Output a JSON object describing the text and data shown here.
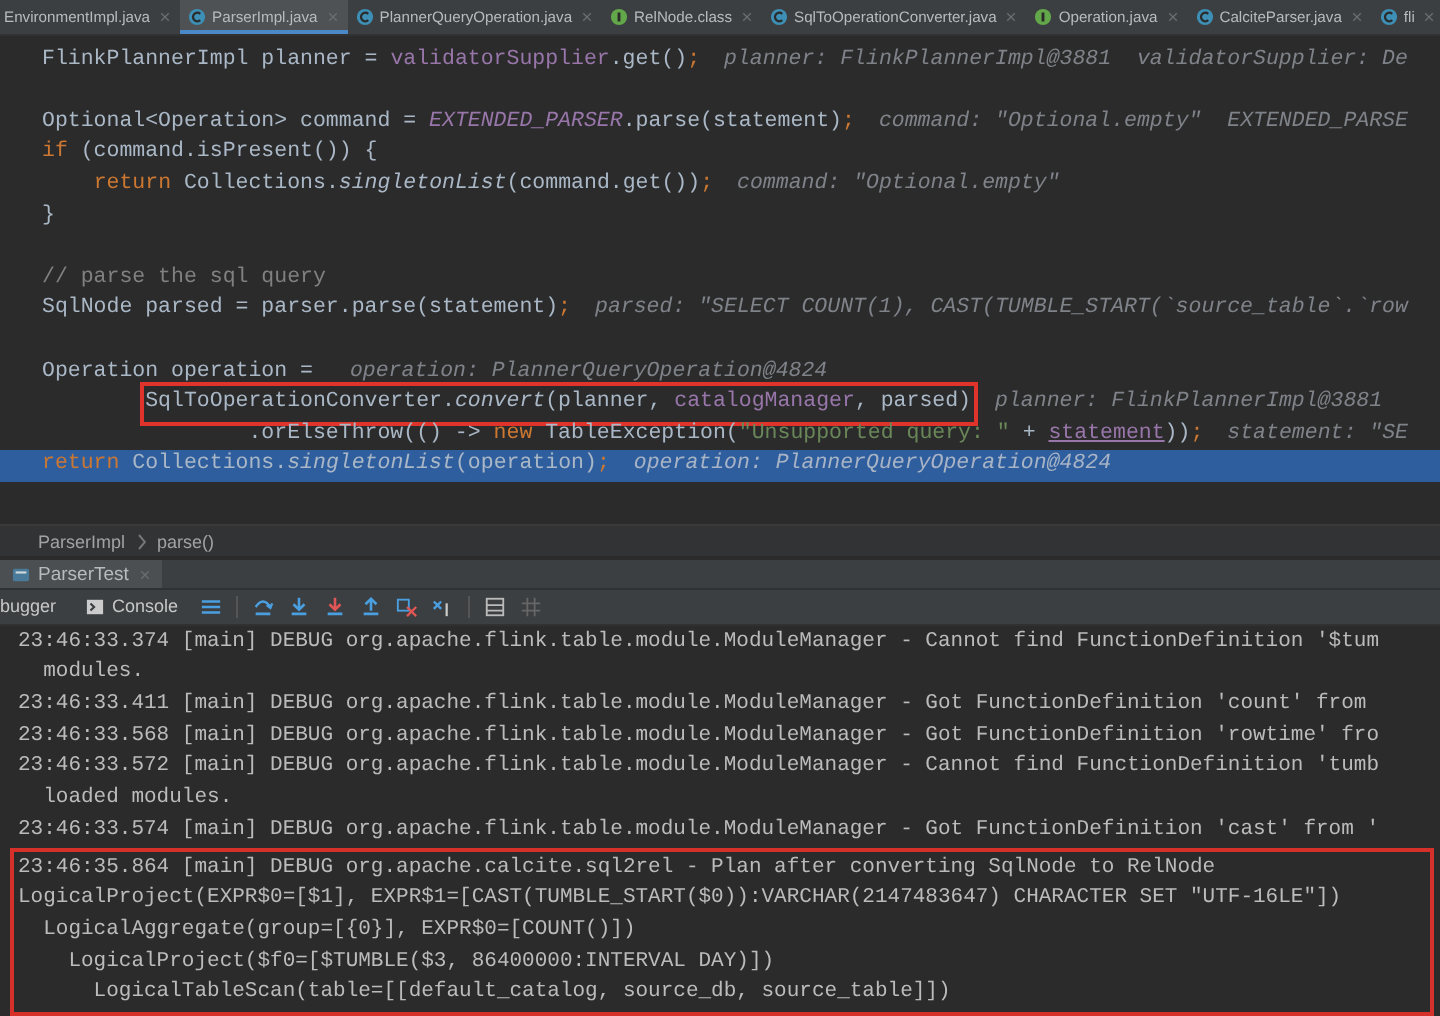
{
  "tabs": [
    {
      "label": "EnvironmentImpl.java",
      "kind": "none",
      "selected": false
    },
    {
      "label": "ParserImpl.java",
      "kind": "java",
      "selected": true
    },
    {
      "label": "PlannerQueryOperation.java",
      "kind": "java",
      "selected": false
    },
    {
      "label": "RelNode.class",
      "kind": "interface",
      "selected": false
    },
    {
      "label": "SqlToOperationConverter.java",
      "kind": "java",
      "selected": false
    },
    {
      "label": "Operation.java",
      "kind": "interface",
      "selected": false
    },
    {
      "label": "CalciteParser.java",
      "kind": "java",
      "selected": false
    },
    {
      "label": "fli",
      "kind": "java",
      "selected": false
    }
  ],
  "code_lines": [
    {
      "kind": "code",
      "current": false,
      "boxed": false,
      "segments": [
        {
          "kind": "plain",
          "text": "FlinkPlannerImpl planner = "
        },
        {
          "kind": "field",
          "text": "validatorSupplier"
        },
        {
          "kind": "plain",
          "text": ".get()"
        },
        {
          "kind": "keyword",
          "text": ";"
        }
      ],
      "hint": "planner: FlinkPlannerImpl@3881  validatorSupplier: De"
    },
    {
      "kind": "blank"
    },
    {
      "kind": "code",
      "current": false,
      "boxed": false,
      "segments": [
        {
          "kind": "plain",
          "text": "Optional<Operation> command = "
        },
        {
          "kind": "static",
          "text": "EXTENDED_PARSER"
        },
        {
          "kind": "plain",
          "text": ".parse(statement)"
        },
        {
          "kind": "keyword",
          "text": ";"
        }
      ],
      "hint": "command: \"Optional.empty\"  EXTENDED_PARSE"
    },
    {
      "kind": "code",
      "current": false,
      "boxed": false,
      "segments": [
        {
          "kind": "keyword",
          "text": "if "
        },
        {
          "kind": "plain",
          "text": "(command.isPresent()) {"
        }
      ]
    },
    {
      "kind": "code",
      "current": false,
      "boxed": false,
      "segments": [
        {
          "kind": "keyword",
          "text": "    return "
        },
        {
          "kind": "plain",
          "text": "Collections."
        },
        {
          "kind": "call",
          "text": "singletonList"
        },
        {
          "kind": "plain",
          "text": "(command.get())"
        },
        {
          "kind": "keyword",
          "text": ";"
        }
      ],
      "hint": "command: \"Optional.empty\""
    },
    {
      "kind": "code",
      "current": false,
      "boxed": false,
      "segments": [
        {
          "kind": "plain",
          "text": "}"
        }
      ]
    },
    {
      "kind": "blank"
    },
    {
      "kind": "code",
      "current": false,
      "boxed": false,
      "segments": [
        {
          "kind": "comment",
          "text": "// parse the sql query"
        }
      ]
    },
    {
      "kind": "code",
      "current": false,
      "boxed": false,
      "segments": [
        {
          "kind": "plain",
          "text": "SqlNode parsed = parser.parse(statement)"
        },
        {
          "kind": "keyword",
          "text": ";"
        }
      ],
      "hint": "parsed: \"SELECT COUNT(1), CAST(TUMBLE_START(`source_table`.`row"
    },
    {
      "kind": "blank"
    },
    {
      "kind": "code",
      "current": false,
      "boxed": false,
      "segments": [
        {
          "kind": "plain",
          "text": "Operation operation = "
        }
      ],
      "hint": "operation: PlannerQueryOperation@4824"
    },
    {
      "kind": "code",
      "current": false,
      "boxed": true,
      "segments": [
        {
          "kind": "plain",
          "text": "        SqlToOperationConverter."
        },
        {
          "kind": "call",
          "text": "convert"
        },
        {
          "kind": "plain",
          "text": "(planner, "
        },
        {
          "kind": "field",
          "text": "catalogManager"
        },
        {
          "kind": "plain",
          "text": ", parsed)"
        }
      ],
      "hint": "planner: FlinkPlannerImpl@3881"
    },
    {
      "kind": "code",
      "current": false,
      "boxed": false,
      "segments": [
        {
          "kind": "plain",
          "text": "                .orElseThrow(() -> "
        },
        {
          "kind": "keyword",
          "text": "new "
        },
        {
          "kind": "plain",
          "text": "TableException("
        },
        {
          "kind": "string",
          "text": "\"Unsupported query: \""
        },
        {
          "kind": "plain",
          "text": " + "
        },
        {
          "kind": "underline",
          "text": "statement"
        },
        {
          "kind": "plain",
          "text": "))"
        },
        {
          "kind": "keyword",
          "text": ";"
        }
      ],
      "hint": "statement: \"SE"
    },
    {
      "kind": "code",
      "current": true,
      "boxed": false,
      "segments": [
        {
          "kind": "keyword",
          "text": "return "
        },
        {
          "kind": "plain",
          "text": "Collections."
        },
        {
          "kind": "call",
          "text": "singletonList"
        },
        {
          "kind": "plain",
          "text": "(operation)"
        },
        {
          "kind": "keyword",
          "text": ";"
        }
      ],
      "hint": "operation: PlannerQueryOperation@4824"
    },
    {
      "kind": "blank"
    }
  ],
  "breadcrumbs": [
    "ParserImpl",
    "parse()"
  ],
  "run_tab": {
    "label": "ParserTest"
  },
  "toolbar_tabs": [
    {
      "label": "bugger"
    },
    {
      "label": "Console"
    }
  ],
  "log_lines": [
    "23:46:33.374 [main] DEBUG org.apache.flink.table.module.ModuleManager - Cannot find FunctionDefinition '$tum",
    "  modules.",
    "23:46:33.411 [main] DEBUG org.apache.flink.table.module.ModuleManager - Got FunctionDefinition 'count' from",
    "23:46:33.568 [main] DEBUG org.apache.flink.table.module.ModuleManager - Got FunctionDefinition 'rowtime' fro",
    "23:46:33.572 [main] DEBUG org.apache.flink.table.module.ModuleManager - Cannot find FunctionDefinition 'tumb",
    "  loaded modules.",
    "23:46:33.574 [main] DEBUG org.apache.flink.table.module.ModuleManager - Got FunctionDefinition 'cast' from '"
  ],
  "boxed_log_lines": [
    "23:46:35.864 [main] DEBUG org.apache.calcite.sql2rel - Plan after converting SqlNode to RelNode",
    "LogicalProject(EXPR$0=[$1], EXPR$1=[CAST(TUMBLE_START($0)):VARCHAR(2147483647) CHARACTER SET \"UTF-16LE\"])",
    "  LogicalAggregate(group=[{0}], EXPR$0=[COUNT()])",
    "    LogicalProject($f0=[$TUMBLE($3, 86400000:INTERVAL DAY)])",
    "      LogicalTableScan(table=[[default_catalog, source_db, source_table]])"
  ]
}
